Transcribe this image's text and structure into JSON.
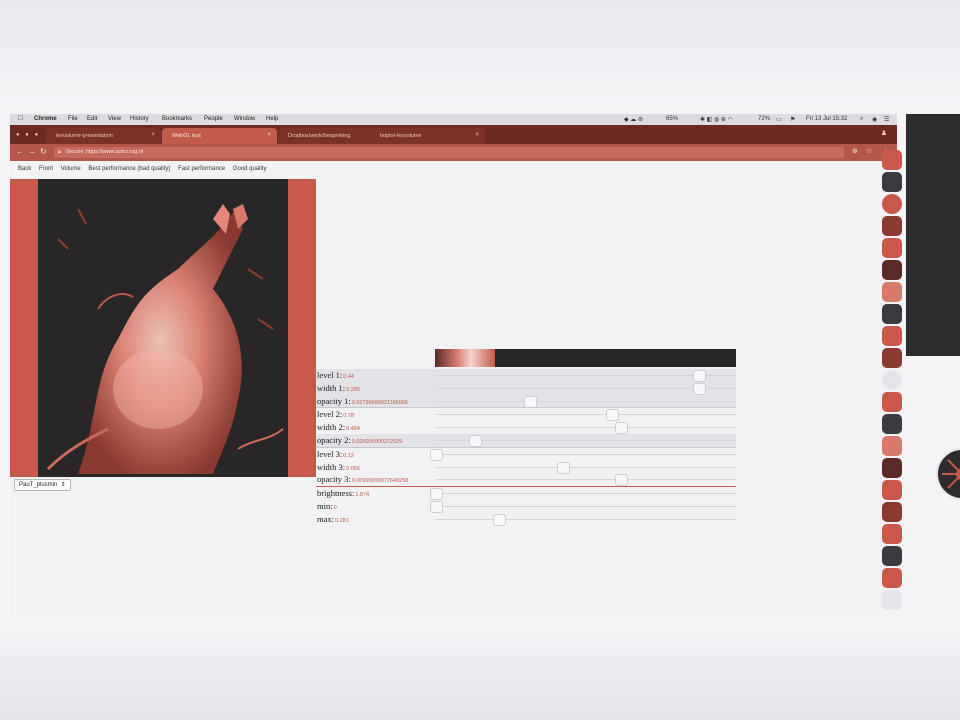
{
  "menubar": {
    "apple": "",
    "items": [
      "Chrome",
      "File",
      "Edit",
      "View",
      "History",
      "Bookmarks",
      "People",
      "Window",
      "Help"
    ],
    "status": {
      "battery_a": "65%",
      "battery_b": "72%",
      "datetime": "Fri 13 Jul 15:32"
    }
  },
  "tabs": [
    {
      "label": "lexvolume-presentation",
      "active": false
    },
    {
      "label": "WebGL test",
      "active": true
    },
    {
      "label": "Dropbox/werk/bespreking",
      "active": false
    },
    {
      "label": "boplot-lexvolume",
      "active": false
    }
  ],
  "address": {
    "secure_label": "Secure",
    "url": "https://www.astro.rug.nl"
  },
  "presets": [
    "Back",
    "Front",
    "Volume",
    "Best performance (bad quality)",
    "Fast performance",
    "Good quality"
  ],
  "controls": [
    {
      "label": "level 1:",
      "value": "0.44",
      "level": 0.877
    },
    {
      "label": "width 1:",
      "value": "0.285",
      "level": 0.877
    },
    {
      "label": "opacity 1:",
      "value": "0.02799999821186066",
      "level": 0.312
    },
    {
      "label": "level 2:",
      "value": "0.78",
      "level": 0.586
    },
    {
      "label": "width 2:",
      "value": "0.484",
      "level": 0.618
    },
    {
      "label": "opacity 2:",
      "value": "0.025000000372529",
      "level": 0.13
    },
    {
      "label": "level 3:",
      "value": "0.12",
      "level": 0.0
    },
    {
      "label": "width 3:",
      "value": "0.056",
      "level": 0.423
    },
    {
      "label": "opacity 3:",
      "value": "0.00999999977648258",
      "level": 0.618
    },
    {
      "label": "brightness:",
      "value": "1.874",
      "level": 0.0
    },
    {
      "label": "min:",
      "value": "0",
      "level": 0.0
    },
    {
      "label": "max:",
      "value": "0.281",
      "level": 0.21
    }
  ],
  "colormap_select": {
    "value": "PauT_plusmin"
  },
  "colors": {
    "accent": "#c25a4d",
    "tab_bar": "#6a2a22",
    "address_bar": "#b4564a",
    "render_bg": "#282626"
  }
}
